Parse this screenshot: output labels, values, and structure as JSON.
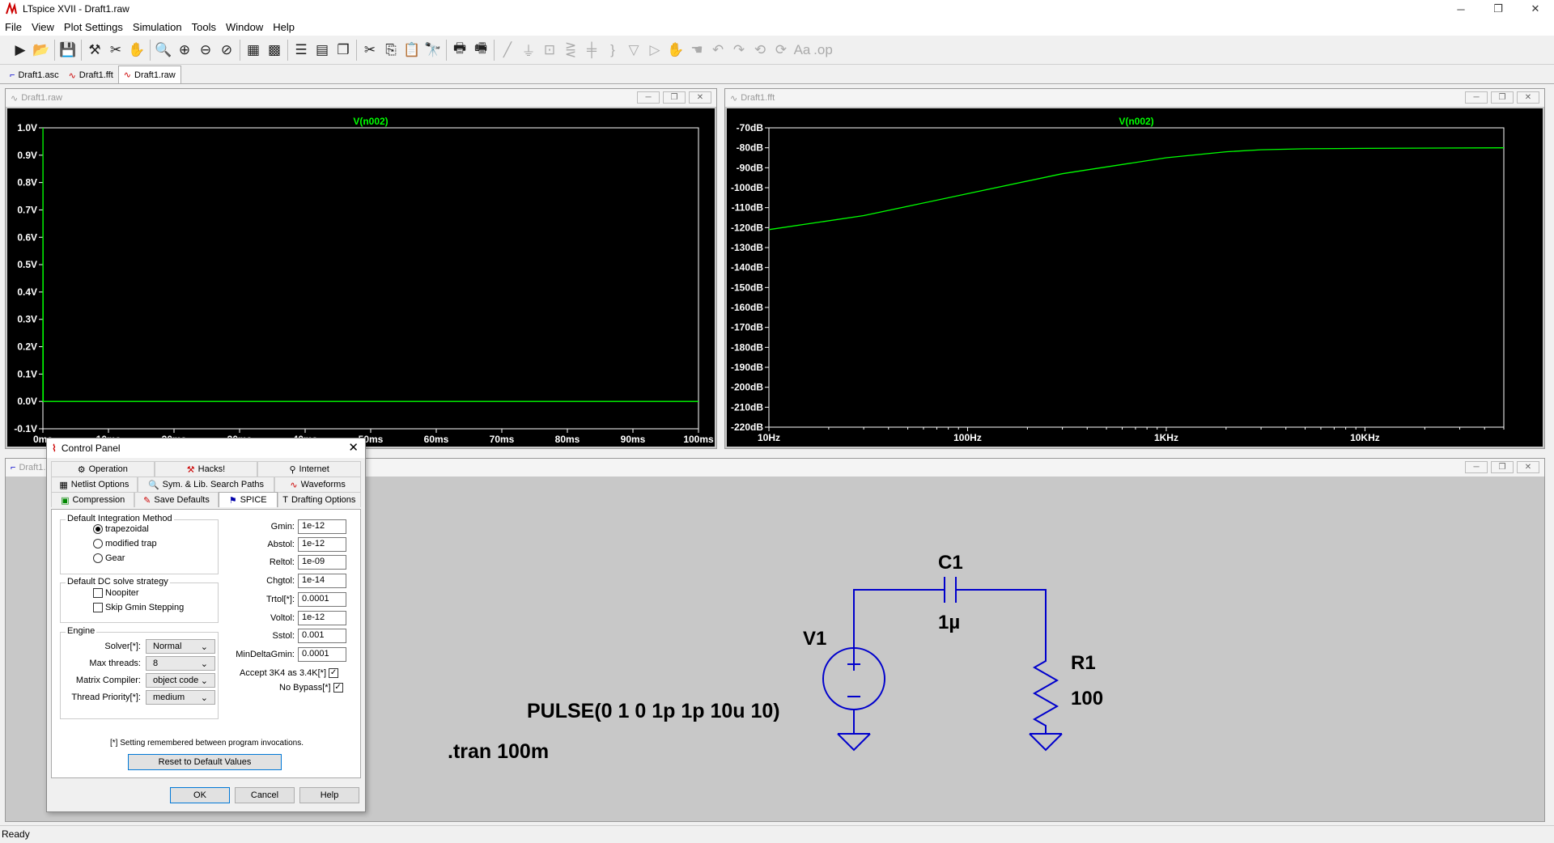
{
  "window": {
    "title": "LTspice XVII - Draft1.raw",
    "min": "─",
    "restore": "❐",
    "close": "✕"
  },
  "menu": [
    "File",
    "View",
    "Plot Settings",
    "Simulation",
    "Tools",
    "Window",
    "Help"
  ],
  "tabs": [
    {
      "label": "Draft1.asc",
      "icon": "schematic-icon"
    },
    {
      "label": "Draft1.fft",
      "icon": "waveform-icon"
    },
    {
      "label": "Draft1.raw",
      "icon": "waveform-icon"
    }
  ],
  "raw_window": {
    "title": "Draft1.raw"
  },
  "fft_window": {
    "title": "Draft1.fft"
  },
  "schem_window": {
    "title": "Draft1.asc"
  },
  "colors": {
    "trace": "#00ff00",
    "plot_bg": "#000000",
    "wire": "#0000cc",
    "schem_bg": "#c8c8c8"
  },
  "chart_data": [
    {
      "type": "line",
      "title": "V(n002)",
      "x_ticks": [
        "0ms",
        "10ms",
        "20ms",
        "30ms",
        "40ms",
        "50ms",
        "60ms",
        "70ms",
        "80ms",
        "90ms",
        "100ms"
      ],
      "y_ticks": [
        "1.0V",
        "0.9V",
        "0.8V",
        "0.7V",
        "0.6V",
        "0.5V",
        "0.4V",
        "0.3V",
        "0.2V",
        "0.1V",
        "0.0V",
        "-0.1V"
      ],
      "xlim": [
        0,
        100
      ],
      "ylim": [
        -0.1,
        1.0
      ],
      "series": [
        {
          "name": "V(n002)",
          "x": [
            0,
            0.01,
            0.05,
            0.2,
            100
          ],
          "y": [
            0,
            1.0,
            0.0,
            0.0,
            0.0
          ]
        }
      ]
    },
    {
      "type": "line",
      "title": "V(n002)",
      "x_scale": "log",
      "x_ticks": [
        "10Hz",
        "100Hz",
        "1KHz",
        "10KHz"
      ],
      "y_ticks": [
        "-70dB",
        "-80dB",
        "-90dB",
        "-100dB",
        "-110dB",
        "-120dB",
        "-130dB",
        "-140dB",
        "-150dB",
        "-160dB",
        "-170dB",
        "-180dB",
        "-190dB",
        "-200dB",
        "-210dB",
        "-220dB"
      ],
      "xlim": [
        10,
        50000
      ],
      "ylim": [
        -220,
        -70
      ],
      "series": [
        {
          "name": "V(n002)",
          "x": [
            10,
            30,
            100,
            300,
            1000,
            2000,
            3000,
            5000,
            10000,
            50000
          ],
          "y": [
            -121,
            -114,
            -103,
            -93,
            -85,
            -82,
            -81,
            -80.5,
            -80.3,
            -80
          ]
        }
      ]
    }
  ],
  "schematic": {
    "c1_name": "C1",
    "c1_value": "1µ",
    "v1_name": "V1",
    "r1_name": "R1",
    "r1_value": "100",
    "source_value": "PULSE(0 1 0 1p 1p 10u 10)",
    "directive": ".tran 100m"
  },
  "control_panel": {
    "title": "Control Panel",
    "close": "✕",
    "tabs_row1": [
      {
        "label": "Operation",
        "icon": "operation-icon"
      },
      {
        "label": "Hacks!",
        "icon": "hacks-icon"
      },
      {
        "label": "Internet",
        "icon": "internet-icon"
      }
    ],
    "tabs_row2": [
      {
        "label": "Netlist Options",
        "icon": "netlist-icon"
      },
      {
        "label": "Sym. & Lib. Search Paths",
        "icon": "search-icon"
      },
      {
        "label": "Waveforms",
        "icon": "waveforms-icon"
      }
    ],
    "tabs_row3": [
      {
        "label": "Compression",
        "icon": "compression-icon"
      },
      {
        "label": "Save Defaults",
        "icon": "save-defaults-icon"
      },
      {
        "label": "SPICE",
        "icon": "spice-icon"
      },
      {
        "label": "Drafting Options",
        "icon": "drafting-icon"
      }
    ],
    "integration_group": "Default Integration Method",
    "integration_options": [
      "trapezoidal",
      "modified trap",
      "Gear"
    ],
    "dc_group": "Default DC solve strategy",
    "dc_options": [
      "Noopiter",
      "Skip Gmin Stepping"
    ],
    "engine_group": "Engine",
    "engine": [
      {
        "label": "Solver[*]:",
        "value": "Normal"
      },
      {
        "label": "Max threads:",
        "value": "8"
      },
      {
        "label": "Matrix Compiler:",
        "value": "object code"
      },
      {
        "label": "Thread Priority[*]:",
        "value": "medium"
      }
    ],
    "params": [
      {
        "label": "Gmin:",
        "value": "1e-12"
      },
      {
        "label": "Abstol:",
        "value": "1e-12"
      },
      {
        "label": "Reltol:",
        "value": "1e-09"
      },
      {
        "label": "Chgtol:",
        "value": "1e-14"
      },
      {
        "label": "Trtol[*]:",
        "value": "0.0001"
      },
      {
        "label": "Voltol:",
        "value": "1e-12"
      },
      {
        "label": "Sstol:",
        "value": "0.001"
      },
      {
        "label": "MinDeltaGmin:",
        "value": "0.0001"
      }
    ],
    "accept_label": "Accept 3K4 as 3.4K[*]",
    "nobypass_label": "No Bypass[*]",
    "note": "[*] Setting remembered between program invocations.",
    "reset": "Reset to Default Values",
    "ok": "OK",
    "cancel": "Cancel",
    "help": "Help"
  },
  "status": "Ready"
}
